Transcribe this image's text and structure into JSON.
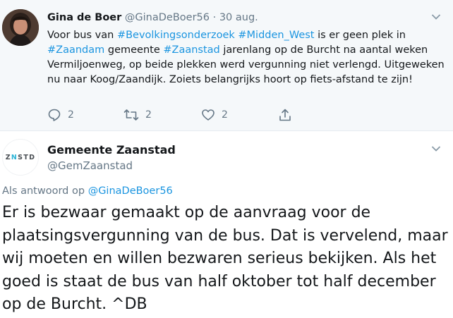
{
  "tweet1": {
    "author_name": "Gina de Boer",
    "author_handle": "@GinaDeBoer56",
    "separator": "·",
    "date": "30 aug.",
    "text": {
      "p1": "Voor bus van ",
      "tag1": "#Bevolkingsonderzoek",
      "sp1": " ",
      "tag2": "#Midden_West",
      "p2": " is er geen plek in ",
      "tag3": "#Zaandam",
      "p3": " gemeente ",
      "tag4": "#Zaanstad",
      "p4": " jarenlang op de Burcht na aantal weken Vermiljoenweg, op beide plekken werd vergunning niet verlengd. Uitgeweken nu naar Koog/Zaandijk. Zoiets belangrijks hoort op fiets-afstand te zijn!"
    },
    "actions": {
      "reply_count": "2",
      "retweet_count": "2",
      "like_count": "2"
    },
    "icons": [
      "avatar-photo",
      "chevron-down-icon",
      "reply-icon",
      "retweet-icon",
      "like-icon",
      "share-icon"
    ]
  },
  "tweet2": {
    "author_name": "Gemeente Zaanstad",
    "author_handle": "@GemZaanstad",
    "avatar_logo": {
      "left": "Z",
      "mid": "N",
      "right": "STD"
    },
    "reply_prefix": "Als antwoord op ",
    "reply_to": "@GinaDeBoer56",
    "text": "Er is bezwaar gemaakt op de aanvraag voor de plaatsingsvergunning van de bus. Dat is vervelend, maar wij moeten en willen bezwaren serieus bekijken. Als het goed is staat de bus van half oktober tot half december op de Burcht. ^DB",
    "icons": [
      "chevron-down-icon"
    ]
  },
  "colors": {
    "link": "#1b95e0",
    "muted": "#657786",
    "text": "#14171a",
    "highlight_bg": "#f5f8fa",
    "logo_accent": "#2bb3d6"
  }
}
